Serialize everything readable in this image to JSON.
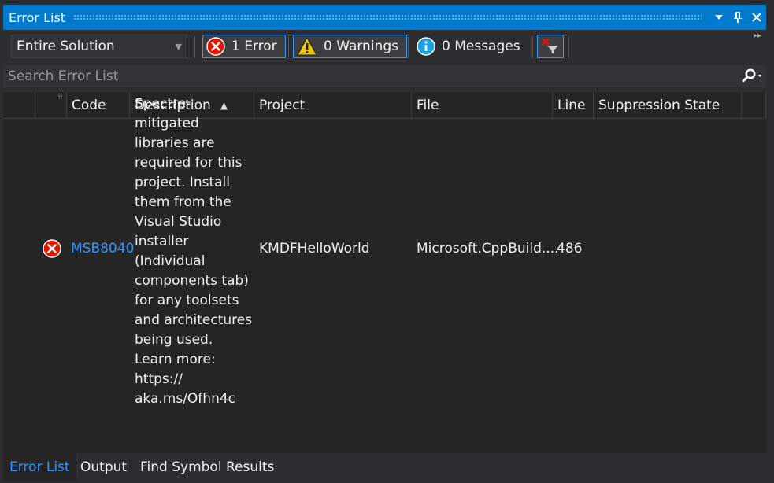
{
  "window": {
    "title": "Error List"
  },
  "toolbar": {
    "scope": "Entire Solution",
    "errors_label": "1 Error",
    "warnings_label": "0 Warnings",
    "messages_label": "0 Messages"
  },
  "search": {
    "placeholder": "Search Error List"
  },
  "columns": {
    "code": "Code",
    "description": "Description",
    "project": "Project",
    "file": "File",
    "line": "Line",
    "suppression": "Suppression State"
  },
  "rows": [
    {
      "code": "MSB8040",
      "description": "Spectre-mitigated libraries are required for this project. Install them from the Visual Studio installer (Individual components tab) for any toolsets and architectures being used. Learn more: https:// aka.ms/Ofhn4c",
      "project": "KMDFHelloWorld",
      "file": "Microsoft.CppBuild....",
      "line": "486",
      "suppression": ""
    }
  ],
  "tabs": [
    "Error List",
    "Output",
    "Find Symbol Results"
  ],
  "colors": {
    "accent": "#007acc",
    "link": "#3794ff",
    "error": "#e51400",
    "warning": "#f0c419",
    "info": "#1ba1e2"
  },
  "icons": {
    "error": "error-circle-icon",
    "warning": "warning-triangle-icon",
    "info": "info-circle-icon",
    "filter": "clear-filter-icon",
    "search": "search-icon"
  }
}
